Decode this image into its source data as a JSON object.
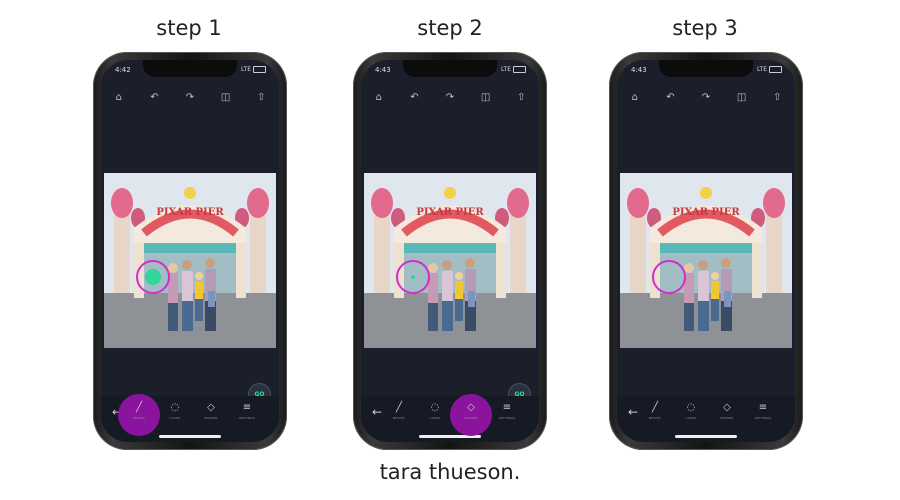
{
  "steps": [
    {
      "title": "step 1",
      "time": "4:42",
      "active_tool": 0,
      "go_label": "GO",
      "dot": "large"
    },
    {
      "title": "step 2",
      "time": "4:43",
      "active_tool": 2,
      "go_label": "GO",
      "dot": "small"
    },
    {
      "title": "step 3",
      "time": "4:43",
      "active_tool": -1,
      "go_label": "",
      "dot": "none"
    }
  ],
  "status": {
    "signal": "LTE"
  },
  "photo": {
    "sign_text": "PIXAR PIER"
  },
  "tools": [
    {
      "label": "BRUSH",
      "icon": "brush-icon"
    },
    {
      "label": "LASSO",
      "icon": "lasso-icon"
    },
    {
      "label": "ERASER",
      "icon": "eraser-icon"
    },
    {
      "label": "SETTINGS",
      "icon": "settings-icon"
    }
  ],
  "toolbar_icons": [
    "home-icon",
    "undo-icon",
    "redo-icon",
    "compare-icon",
    "share-icon"
  ],
  "credit": "tara thueson.",
  "colors": {
    "accent_purple": "#8b149f",
    "ring_magenta": "#d02ec9",
    "go_green": "#2fe0a2",
    "app_bg": "#1b1f2c"
  }
}
